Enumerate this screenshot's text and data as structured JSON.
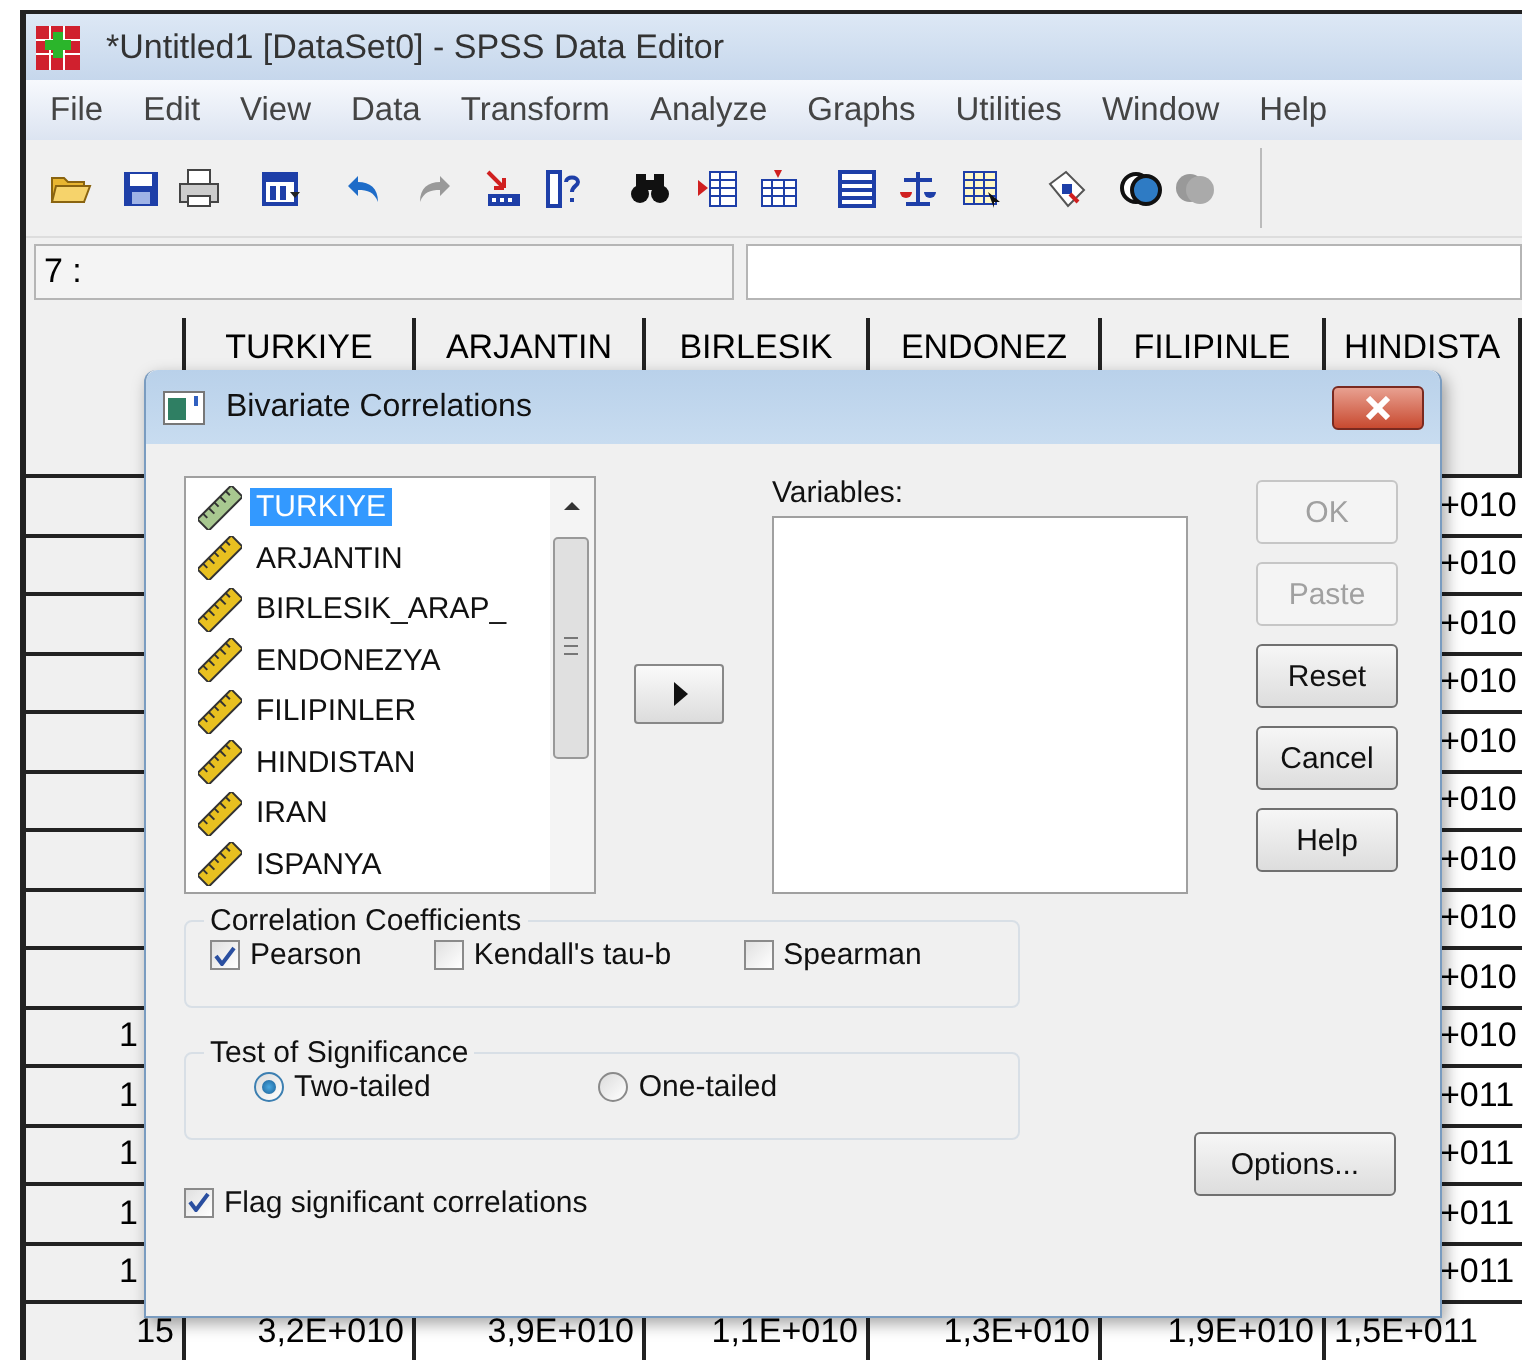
{
  "window": {
    "title": "*Untitled1 [DataSet0] - SPSS Data Editor"
  },
  "menu": [
    "File",
    "Edit",
    "View",
    "Data",
    "Transform",
    "Analyze",
    "Graphs",
    "Utilities",
    "Window",
    "Help"
  ],
  "cell_reference": "7 :",
  "grid": {
    "columns": [
      "TURKIYE",
      "ARJANTIN",
      "BIRLESIK",
      "ENDONEZ",
      "FILIPINLE",
      "HINDISTA"
    ],
    "rows": [
      {
        "kind": "covered",
        "last_cell": "+010"
      },
      {
        "kind": "covered",
        "last_cell": "+010"
      },
      {
        "kind": "covered",
        "last_cell": "+010"
      },
      {
        "kind": "covered",
        "last_cell": "+010"
      },
      {
        "kind": "covered",
        "last_cell": "+010"
      },
      {
        "kind": "covered",
        "last_cell": "+010"
      },
      {
        "kind": "covered",
        "last_cell": "+010"
      },
      {
        "kind": "covered",
        "last_cell": "+010"
      },
      {
        "kind": "covered",
        "last_cell": "+010"
      },
      {
        "kind": "covered",
        "row_number": "1",
        "last_cell": "+010"
      },
      {
        "kind": "covered",
        "row_number": "1",
        "last_cell": "+011"
      },
      {
        "kind": "covered",
        "row_number": "1",
        "last_cell": "+011"
      },
      {
        "kind": "covered",
        "row_number": "1",
        "last_cell": "+011"
      },
      {
        "kind": "covered",
        "row_number": "1",
        "last_cell": "+011"
      },
      {
        "kind": "full",
        "row_number": "15",
        "cells": [
          "3,2E+010",
          "3,9E+010",
          "1,1E+010",
          "1,3E+010",
          "1,9E+010",
          "1,5E+011"
        ]
      }
    ]
  },
  "dialog": {
    "title": "Bivariate Correlations",
    "source_list": [
      {
        "label": "TURKIYE",
        "selected": true
      },
      {
        "label": "ARJANTIN",
        "selected": false
      },
      {
        "label": "BIRLESIK_ARAP_",
        "selected": false
      },
      {
        "label": "ENDONEZYA",
        "selected": false
      },
      {
        "label": "FILIPINLER",
        "selected": false
      },
      {
        "label": "HINDISTAN",
        "selected": false
      },
      {
        "label": "IRAN",
        "selected": false
      },
      {
        "label": "ISPANYA",
        "selected": false
      }
    ],
    "variables_label": "Variables:",
    "buttons": [
      {
        "label": "OK",
        "disabled": true
      },
      {
        "label": "Paste",
        "disabled": true
      },
      {
        "label": "Reset",
        "disabled": false
      },
      {
        "label": "Cancel",
        "disabled": false
      },
      {
        "label": "Help",
        "disabled": false
      }
    ],
    "correlation_coefficients": {
      "title": "Correlation Coefficients",
      "options": [
        {
          "label": "Pearson",
          "checked": true
        },
        {
          "label": "Kendall's tau-b",
          "checked": false
        },
        {
          "label": "Spearman",
          "checked": false
        }
      ]
    },
    "test_of_significance": {
      "title": "Test of Significance",
      "options": [
        {
          "label": "Two-tailed",
          "selected": true
        },
        {
          "label": "One-tailed",
          "selected": false
        }
      ]
    },
    "flag_significant": {
      "label": "Flag significant correlations",
      "checked": true
    },
    "options_button": "Options..."
  }
}
